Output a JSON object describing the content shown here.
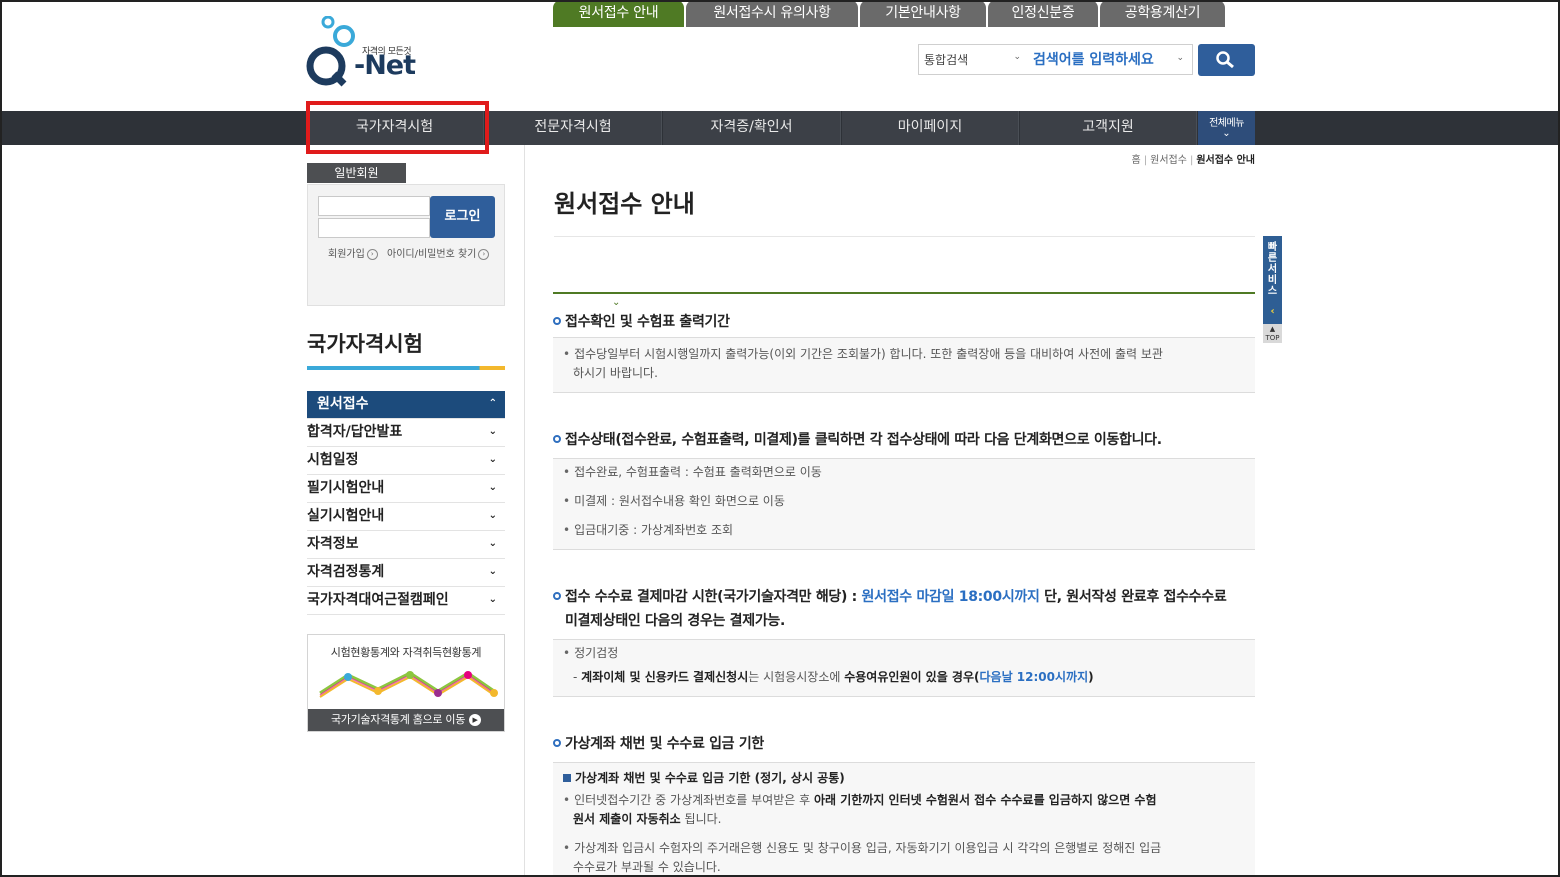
{
  "header": {
    "logo_tagline": "자격의 모든것",
    "logo_text": "-Net",
    "search_scope": "통합검색",
    "search_placeholder": "검색어를 입력하세요"
  },
  "nav": {
    "items": [
      "국가자격시험",
      "전문자격시험",
      "자격증/확인서",
      "마이페이지",
      "고객지원"
    ],
    "all_menu": "전체메뉴"
  },
  "sidebar": {
    "member_tab": "일반회원",
    "login_button": "로그인",
    "signup_link": "회원가입",
    "find_link": "아이디/비밀번호 찾기",
    "section_title": "국가자격시험",
    "menu": [
      {
        "label": "원서접수",
        "active": true
      },
      {
        "label": "합격자/답안발표"
      },
      {
        "label": "시험일정"
      },
      {
        "label": "필기시험안내"
      },
      {
        "label": "실기시험안내"
      },
      {
        "label": "자격정보"
      },
      {
        "label": "자격검정통계"
      },
      {
        "label": "국가자격대여근절캠페인"
      }
    ],
    "stats_title": "시험현황통계와 자격취득현황통계",
    "stats_link": "국가기술자격통계 홈으로 이동"
  },
  "breadcrumb": [
    "홈",
    "원서접수",
    "원서접수 안내"
  ],
  "main": {
    "title": "원서접수 안내",
    "tabs": [
      "원서접수 안내",
      "원서접수시 유의사항",
      "기본안내사항",
      "인정신분증",
      "공학용계산기"
    ],
    "sections": {
      "s1_head": "접수확인 및 수험표 출력기간",
      "s1_b1_line1": "접수당일부터 시험시행일까지 출력가능(이외 기간은 조회불가) 합니다. 또한 출력장애 등을 대비하여 사전에 출력 보관",
      "s1_b1_line2": "하시기 바랍니다.",
      "s2_head": "접수상태(접수완료, 수험표출력, 미결제)를 클릭하면 각 접수상태에 따라 다음 단계화면으로 이동합니다.",
      "s2_b1": "접수완료, 수험표출력 : 수험표 출력화면으로 이동",
      "s2_b2": "미결제 : 원서접수내용 확인 화면으로 이동",
      "s2_b3": "입금대기중 : 가상계좌번호 조회",
      "s3_head_a": "접수 수수료 결제마감 시한(국가기술자격만 해당) : ",
      "s3_head_b": "원서접수 마감일 18:00시까지",
      "s3_head_c": " 단, 원서작성 완료후 접수수수료",
      "s3_head_line2": "미결제상태인 다음의 경우는 결제가능.",
      "s3_b1": "정기검정",
      "s3_sub_a": "- ",
      "s3_sub_b": "계좌이체 및 신용카드 결제신청시",
      "s3_sub_c": "는 시험응시장소에 ",
      "s3_sub_d": "수용여유인원이 있을 경우",
      "s3_sub_e": "(",
      "s3_sub_f": "다음날 12:00시까지",
      "s3_sub_g": ")",
      "s4_head": "가상계좌 채번 및 수수료 입금 기한",
      "s4_sub_title": "가상계좌 채번 및 수수료 입금 기한 (정기, 상시 공통)",
      "s4_b1_a": "인터넷접수기간 중 가상계좌번호를 부여받은 후 ",
      "s4_b1_b": "아래 기한까지 인터넷 수험원서 접수 수수료를 입금하지 않으면 수험",
      "s4_b1_line2_a": "원서 제출이 자동취소",
      "s4_b1_line2_b": " 됩니다.",
      "s4_b2_line1": "가상계좌 입금시 수험자의 주거래은행 신용도 및 창구이용 입금, 자동화기기 이용입금 시 각각의 은행별로 정해진 입금",
      "s4_b2_line2": "수수료가 부과될 수 있습니다."
    }
  },
  "quick": {
    "label": "빠른서비스",
    "top": "TOP"
  },
  "colors": {
    "nav_bg": "#3c4047",
    "brand_blue": "#2f5e9b",
    "tab_active": "#4f7a24",
    "highlight": "#e01b1b"
  }
}
